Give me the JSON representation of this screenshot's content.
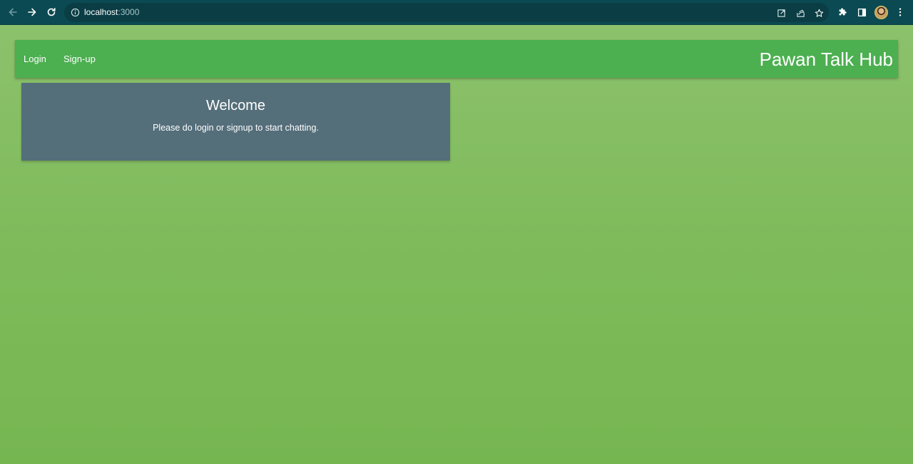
{
  "browser": {
    "url_host": "localhost",
    "url_port": ":3000",
    "icons": {
      "back": "arrow-left-icon",
      "forward": "arrow-right-icon",
      "reload": "reload-icon",
      "site_info": "info-icon",
      "open_external": "open-external-icon",
      "share": "share-icon",
      "bookmark": "star-icon",
      "extensions": "puzzle-icon",
      "side_panel": "side-panel-icon",
      "profile": "avatar",
      "menu": "kebab-menu-icon"
    },
    "colors": {
      "toolbar": "#0b4a52",
      "omnibox": "#0a3d44"
    }
  },
  "navbar": {
    "links": [
      {
        "label": "Login"
      },
      {
        "label": "Sign-up"
      }
    ],
    "brand": "Pawan Talk Hub",
    "color": "#4caf50"
  },
  "welcome": {
    "title": "Welcome",
    "message": "Please do login or signup to start chatting.",
    "color": "#546e7a"
  },
  "page": {
    "background_top": "#8ec26f",
    "background_bottom": "#76b651"
  }
}
